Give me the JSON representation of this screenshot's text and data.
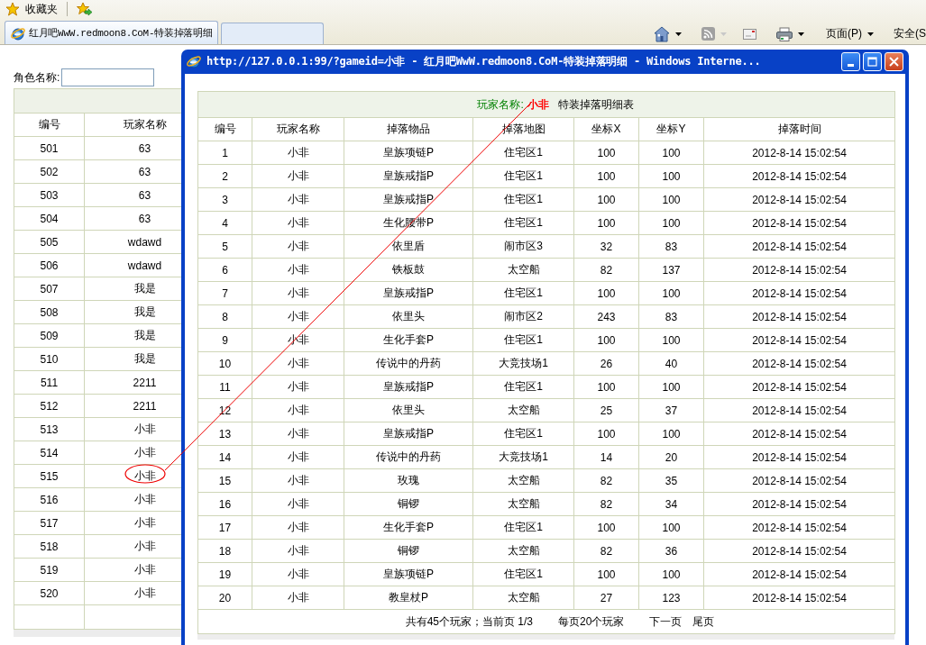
{
  "favorites": {
    "label": "收藏夹"
  },
  "tabs": [
    {
      "title": "红月吧WwW.redmoon8.CoM-特装掉落明细",
      "selected": true
    }
  ],
  "command_bar": [
    "页面(P)",
    "安全(S"
  ],
  "page": {
    "search_label": "角色名称:",
    "table": {
      "columns": [
        "编号",
        "玩家名称"
      ],
      "rows": [
        [
          "501",
          "63"
        ],
        [
          "502",
          "63"
        ],
        [
          "503",
          "63"
        ],
        [
          "504",
          "63"
        ],
        [
          "505",
          "wdawd"
        ],
        [
          "506",
          "wdawd"
        ],
        [
          "507",
          "我是"
        ],
        [
          "508",
          "我是"
        ],
        [
          "509",
          "我是"
        ],
        [
          "510",
          "我是"
        ],
        [
          "511",
          "2211"
        ],
        [
          "512",
          "2211"
        ],
        [
          "513",
          "小非"
        ],
        [
          "514",
          "小非"
        ],
        [
          "515",
          "小非"
        ],
        [
          "516",
          "小非"
        ],
        [
          "517",
          "小非"
        ],
        [
          "518",
          "小非"
        ],
        [
          "519",
          "小非"
        ],
        [
          "520",
          "小非"
        ]
      ]
    }
  },
  "popup": {
    "title": "http://127.0.0.1:99/?gameid=小非 - 红月吧WwW.redmoon8.CoM-特装掉落明细 - Windows Interne...",
    "player_label": "玩家名称:",
    "player_name": "小非",
    "caption": "特装掉落明细表",
    "columns": [
      "编号",
      "玩家名称",
      "掉落物品",
      "掉落地图",
      "坐标X",
      "坐标Y",
      "掉落时间"
    ],
    "rows": [
      [
        "1",
        "小非",
        "皇族项链P",
        "住宅区1",
        "100",
        "100",
        "2012-8-14 15:02:54"
      ],
      [
        "2",
        "小非",
        "皇族戒指P",
        "住宅区1",
        "100",
        "100",
        "2012-8-14 15:02:54"
      ],
      [
        "3",
        "小非",
        "皇族戒指P",
        "住宅区1",
        "100",
        "100",
        "2012-8-14 15:02:54"
      ],
      [
        "4",
        "小非",
        "生化腰带P",
        "住宅区1",
        "100",
        "100",
        "2012-8-14 15:02:54"
      ],
      [
        "5",
        "小非",
        "依里盾",
        "闹市区3",
        "32",
        "83",
        "2012-8-14 15:02:54"
      ],
      [
        "6",
        "小非",
        "铁板鼓",
        "太空船",
        "82",
        "137",
        "2012-8-14 15:02:54"
      ],
      [
        "7",
        "小非",
        "皇族戒指P",
        "住宅区1",
        "100",
        "100",
        "2012-8-14 15:02:54"
      ],
      [
        "8",
        "小非",
        "依里头",
        "闹市区2",
        "243",
        "83",
        "2012-8-14 15:02:54"
      ],
      [
        "9",
        "小非",
        "生化手套P",
        "住宅区1",
        "100",
        "100",
        "2012-8-14 15:02:54"
      ],
      [
        "10",
        "小非",
        "传说中的丹药",
        "大竞技场1",
        "26",
        "40",
        "2012-8-14 15:02:54"
      ],
      [
        "11",
        "小非",
        "皇族戒指P",
        "住宅区1",
        "100",
        "100",
        "2012-8-14 15:02:54"
      ],
      [
        "12",
        "小非",
        "依里头",
        "太空船",
        "25",
        "37",
        "2012-8-14 15:02:54"
      ],
      [
        "13",
        "小非",
        "皇族戒指P",
        "住宅区1",
        "100",
        "100",
        "2012-8-14 15:02:54"
      ],
      [
        "14",
        "小非",
        "传说中的丹药",
        "大竞技场1",
        "14",
        "20",
        "2012-8-14 15:02:54"
      ],
      [
        "15",
        "小非",
        "玫瑰",
        "太空船",
        "82",
        "35",
        "2012-8-14 15:02:54"
      ],
      [
        "16",
        "小非",
        "铜锣",
        "太空船",
        "82",
        "34",
        "2012-8-14 15:02:54"
      ],
      [
        "17",
        "小非",
        "生化手套P",
        "住宅区1",
        "100",
        "100",
        "2012-8-14 15:02:54"
      ],
      [
        "18",
        "小非",
        "铜锣",
        "太空船",
        "82",
        "36",
        "2012-8-14 15:02:54"
      ],
      [
        "19",
        "小非",
        "皇族项链P",
        "住宅区1",
        "100",
        "100",
        "2012-8-14 15:02:54"
      ],
      [
        "20",
        "小非",
        "教皇杖P",
        "太空船",
        "27",
        "123",
        "2012-8-14 15:02:54"
      ]
    ],
    "footer": {
      "summary": "共有45个玩家；当前页 1/3",
      "per_page": "每页20个玩家",
      "links": [
        "下一页",
        "尾页"
      ]
    }
  }
}
